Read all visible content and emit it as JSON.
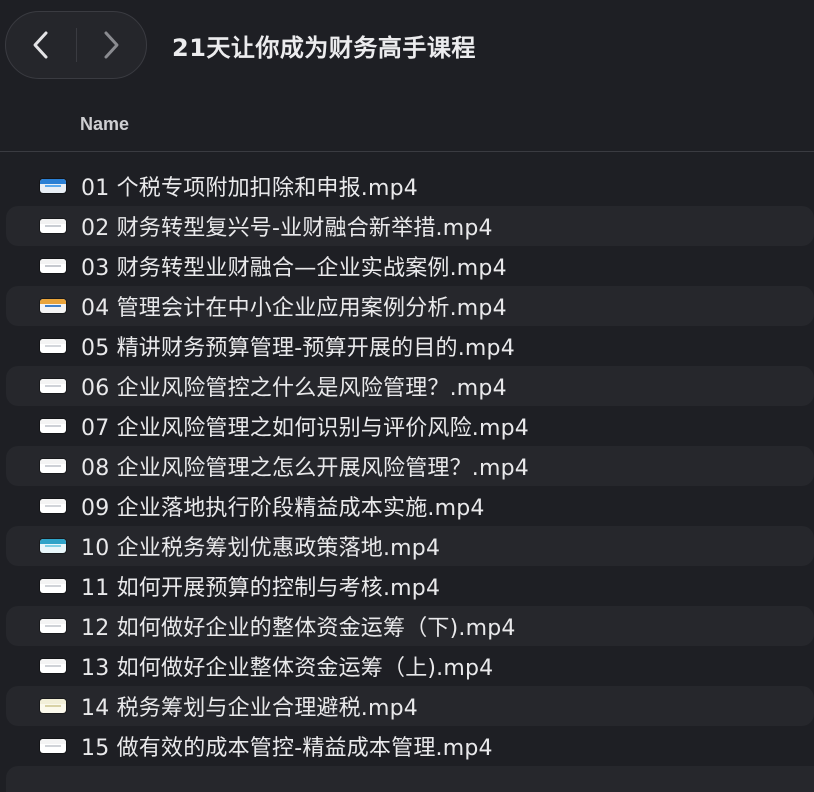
{
  "window": {
    "title": "21天让你成为财务高手课程"
  },
  "toolbar": {
    "back_icon": "chevron-left-icon",
    "forward_icon": "chevron-right-icon"
  },
  "columns": {
    "name": "Name"
  },
  "files": [
    {
      "name": "01 个税专项附加扣除和申报.mp4",
      "thumb": [
        "#2a7fd4",
        "#5aa9ee",
        "#e8eef5"
      ]
    },
    {
      "name": "02 财务转型复兴号-业财融合新举措.mp4",
      "thumb": [
        "#f2f2f2",
        "#c9cdd3",
        "#ffffff"
      ]
    },
    {
      "name": "03 财务转型业财融合—企业实战案例.mp4",
      "thumb": [
        "#f3f3f3",
        "#c6c9cf",
        "#ffffff"
      ]
    },
    {
      "name": "04 管理会计在中小企业应用案例分析.mp4",
      "thumb": [
        "#e9a43b",
        "#3f7fc8",
        "#f4f4f4"
      ]
    },
    {
      "name": "05 精讲财务预算管理-预算开展的目的.mp4",
      "thumb": [
        "#f4f4f4",
        "#d3d6db",
        "#ffffff"
      ]
    },
    {
      "name": "06 企业风险管控之什么是风险管理？.mp4",
      "thumb": [
        "#f4f4f4",
        "#cfd2d8",
        "#ffffff"
      ]
    },
    {
      "name": "07 企业风险管理之如何识别与评价风险.mp4",
      "thumb": [
        "#f4f4f4",
        "#cdd0d6",
        "#ffffff"
      ]
    },
    {
      "name": "08 企业风险管理之怎么开展风险管理？.mp4",
      "thumb": [
        "#f4f4f4",
        "#cdd0d6",
        "#ffffff"
      ]
    },
    {
      "name": "09 企业落地执行阶段精益成本实施.mp4",
      "thumb": [
        "#f4f4f4",
        "#d1d4d9",
        "#ffffff"
      ]
    },
    {
      "name": "10 企业税务筹划优惠政策落地.mp4",
      "thumb": [
        "#2fa3c8",
        "#7fd0e6",
        "#e8f6fa"
      ]
    },
    {
      "name": "11 如何开展预算的控制与考核.mp4",
      "thumb": [
        "#f4f4f4",
        "#d0d3d8",
        "#ffffff"
      ]
    },
    {
      "name": "12 如何做好企业的整体资金运筹（下).mp4",
      "thumb": [
        "#f4f4f4",
        "#cfd2d7",
        "#ffffff"
      ]
    },
    {
      "name": "13 如何做好企业整体资金运筹（上).mp4",
      "thumb": [
        "#f4f4f4",
        "#cfd2d7",
        "#ffffff"
      ]
    },
    {
      "name": "14 税务筹划与企业合理避税.mp4",
      "thumb": [
        "#f2efd8",
        "#d8d2a6",
        "#fbf9ec"
      ]
    },
    {
      "name": "15 做有效的成本管控-精益成本管理.mp4",
      "thumb": [
        "#f4f4f4",
        "#d0d3d8",
        "#ffffff"
      ]
    }
  ]
}
